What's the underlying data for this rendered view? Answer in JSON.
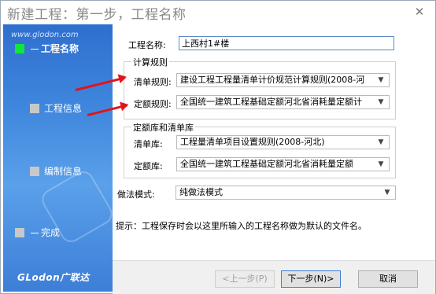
{
  "window": {
    "title": "新建工程：第一步，工程名称",
    "close_glyph": "✕"
  },
  "sidebar": {
    "brand": "www.glodon.com",
    "logo": "GLodon广联达",
    "steps": [
      {
        "label": "工程名称",
        "active": true
      },
      {
        "label": "工程信息",
        "active": false
      },
      {
        "label": "编制信息",
        "active": false
      },
      {
        "label": "完成",
        "active": false
      }
    ]
  },
  "form": {
    "project_name_label": "工程名称:",
    "project_name_value": "上西村1#楼",
    "calc_rules": {
      "group_title": "计算规则",
      "bill_rule_label": "清单规则:",
      "bill_rule_value": "建设工程工程量清单计价规范计算规则(2008-河",
      "quota_rule_label": "定额规则:",
      "quota_rule_value": "全国统一建筑工程基础定额河北省消耗量定额计"
    },
    "libraries": {
      "group_title": "定额库和清单库",
      "bill_lib_label": "清单库:",
      "bill_lib_value": "工程量清单项目设置规则(2008-河北)",
      "quota_lib_label": "定额库:",
      "quota_lib_value": "全国统一建筑工程基础定额河北省消耗量定额"
    },
    "method_label": "做法模式:",
    "method_value": "纯做法模式",
    "hint": "提示：工程保存时会以这里所输入的工程名称做为默认的文件名。"
  },
  "buttons": {
    "prev": "<上一步(P)",
    "next": "下一步(N)>",
    "cancel": "取消"
  },
  "icons": {
    "dropdown": "chevron-down-icon",
    "close": "close-icon"
  },
  "colors": {
    "sidebar_blue": "#3e86dd",
    "active_step": "#12e53a",
    "annotation_arrow": "#e0151b"
  }
}
